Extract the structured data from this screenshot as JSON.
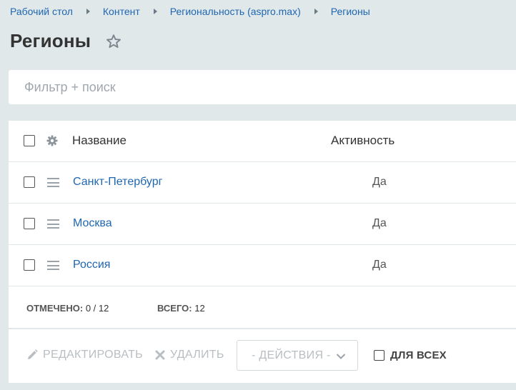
{
  "breadcrumb": {
    "items": [
      "Рабочий стол",
      "Контент",
      "Региональность (aspro.max)",
      "Регионы"
    ]
  },
  "page": {
    "title": "Регионы"
  },
  "filter": {
    "placeholder": "Фильтр + поиск",
    "value": ""
  },
  "table": {
    "columns": {
      "name": "Название",
      "active": "Активность"
    },
    "rows": [
      {
        "name": "Санкт-Петербург",
        "active": "Да"
      },
      {
        "name": "Москва",
        "active": "Да"
      },
      {
        "name": "Россия",
        "active": "Да"
      }
    ]
  },
  "summary": {
    "selected_label": "ОТМЕЧЕНО:",
    "selected_value": "0 / 12",
    "total_label": "ВСЕГО:",
    "total_value": "12"
  },
  "actions": {
    "edit_label": "РЕДАКТИРОВАТЬ",
    "delete_label": "УДАЛИТЬ",
    "actions_select": "- ДЕЙСТВИЯ -",
    "for_all_label": "ДЛЯ ВСЕХ"
  },
  "colors": {
    "link": "#2067b0",
    "background": "#e0e8ea",
    "disabled": "#b8bec2"
  },
  "icons": {
    "favorite": "star-icon",
    "settings": "gear-icon",
    "drag": "drag-handle-icon",
    "edit": "pencil-icon",
    "delete": "cross-icon",
    "dropdown": "chevron-down-icon"
  }
}
